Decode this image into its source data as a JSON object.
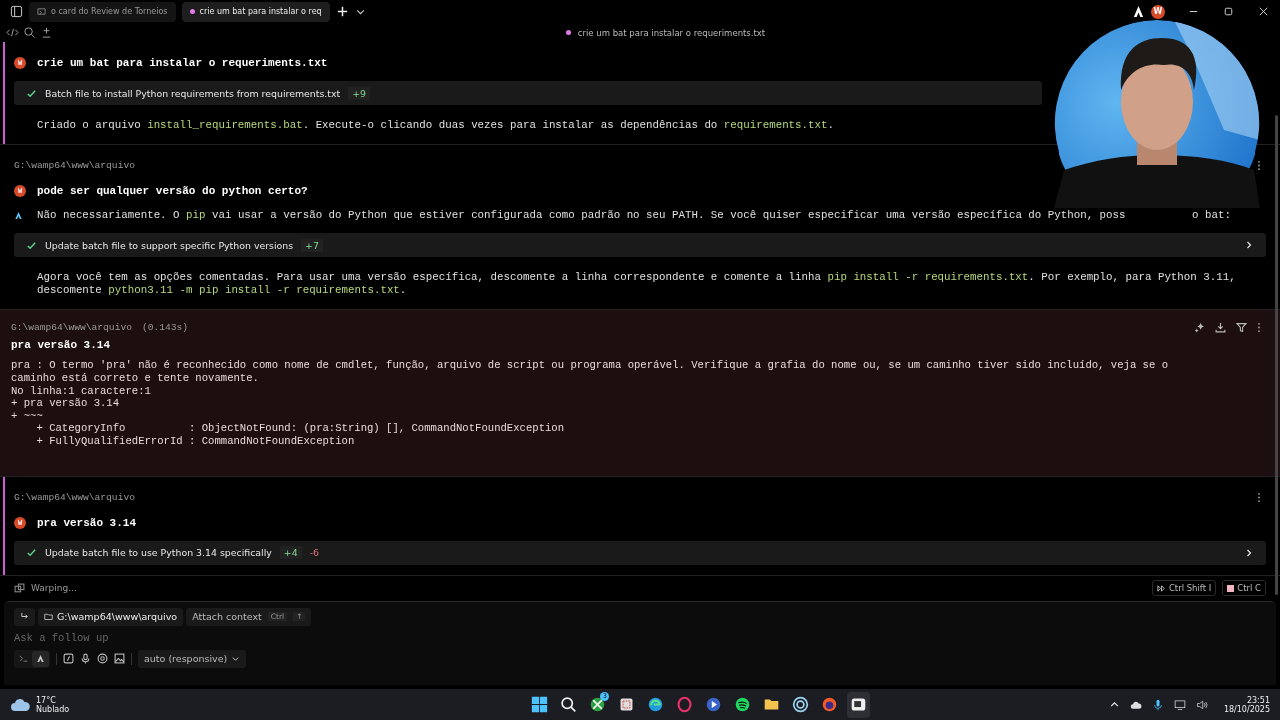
{
  "tabs": [
    {
      "kind": "terminal",
      "label": "o card do Review de Torneios",
      "selected": false
    },
    {
      "kind": "chat",
      "label": "crie um bat para instalar o req",
      "selected": true
    }
  ],
  "title_avatar": "W",
  "session_title": "crie um bat para instalar o requeriments.txt",
  "exchanges": [
    {
      "kind": "chat",
      "active": true,
      "items": [
        {
          "kind": "prompt",
          "avatar": "W",
          "text": "crie um bat para instalar o requeriments.txt"
        },
        {
          "kind": "card",
          "text": "Batch file to install Python requirements from requirements.txt",
          "added": "+9",
          "chevron": false
        },
        {
          "kind": "answer",
          "segments": [
            {
              "kind": "text",
              "text": "Criado o arquivo "
            },
            {
              "kind": "code",
              "text": "install_requirements.bat"
            },
            {
              "kind": "text",
              "text": ". Execute-o clicando duas vezes para instalar as dependências do "
            },
            {
              "kind": "code",
              "text": "requirements.txt"
            },
            {
              "kind": "text",
              "text": "."
            }
          ]
        }
      ]
    },
    {
      "kind": "chat",
      "active": false,
      "path": "G:\\wamp64\\www\\arquivo",
      "items": [
        {
          "kind": "prompt",
          "avatar": "W",
          "text": "pode ser qualquer versão do python certo?"
        },
        {
          "kind": "agent",
          "segments": [
            {
              "kind": "text",
              "text": "Não necessariamente. O "
            },
            {
              "kind": "code",
              "text": "pip"
            },
            {
              "kind": "text",
              "text": " vai usar a versão do Python que estiver configurada como padrão no seu PATH. Se você quiser especificar uma versão específica do Python, poss"
            }
          ],
          "tail": "o bat:"
        },
        {
          "kind": "card",
          "text": "Update batch file to support specific Python versions",
          "added": "+7",
          "chevron": true
        },
        {
          "kind": "answer",
          "segments": [
            {
              "kind": "text",
              "text": "Agora você tem as opções comentadas. Para usar uma versão específica, descomente a linha correspondente e comente a linha "
            },
            {
              "kind": "code",
              "text": "pip install -r requirements.txt"
            },
            {
              "kind": "text",
              "text": ". Por exemplo, para Python 3.11, descomente "
            },
            {
              "kind": "code",
              "text": "python3.11 -m pip install -r requirements.txt"
            },
            {
              "kind": "text",
              "text": "."
            }
          ]
        }
      ]
    },
    {
      "kind": "command",
      "path": "G:\\wamp64\\www\\arquivo",
      "duration": "(0.143s)",
      "command": "pra versão 3.14",
      "output": [
        "pra : O termo 'pra' não é reconhecido como nome de cmdlet, função, arquivo de script ou programa operável. Verifique a grafia do nome ou, se um caminho tiver sido incluído, veja se o",
        "caminho está correto e tente novamente.",
        "No linha:1 caractere:1",
        "+ pra versão 3.14",
        "+ ~~~",
        "    + CategoryInfo          : ObjectNotFound: (pra:String) [], CommandNotFoundException",
        "    + FullyQualifiedErrorId : CommandNotFoundException"
      ]
    },
    {
      "kind": "chat",
      "active": true,
      "path": "G:\\wamp64\\www\\arquivo",
      "items": [
        {
          "kind": "prompt",
          "avatar": "W",
          "text": "pra versão 3.14"
        },
        {
          "kind": "card",
          "text": "Update batch file to use Python 3.14 specifically",
          "added": "+4",
          "removed": "-6",
          "chevron": true
        }
      ]
    }
  ],
  "status": {
    "text": "Warping...",
    "chips": [
      {
        "kind": "stop",
        "label": "Ctrl Shift I"
      },
      {
        "kind": "cancel",
        "label": "Ctrl C"
      }
    ]
  },
  "input": {
    "directory": "G:\\wamp64\\www\\arquivo",
    "attach": "Attach context",
    "attach_keys": [
      "Ctrl",
      "↑"
    ],
    "placeholder": "Ask a follow up",
    "modes": [
      {
        "kind": "terminal",
        "selected": false
      },
      {
        "kind": "agent",
        "selected": true
      }
    ],
    "model": "auto (responsive)"
  },
  "taskbar": {
    "temperature": "17°C",
    "weather": "Nublado",
    "xbox_badge": "3",
    "time": "23:51",
    "date": "18/10/2025"
  }
}
